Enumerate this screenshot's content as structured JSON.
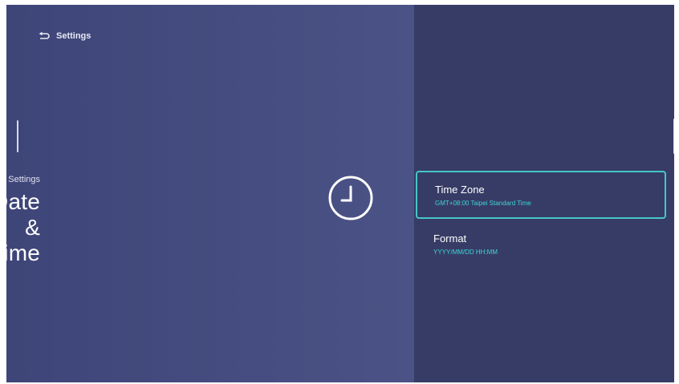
{
  "nav": {
    "back_label": "Settings",
    "back_icon": "back-arrow-icon"
  },
  "header": {
    "subtitle": "Settings",
    "title": "Date & Time",
    "icon": "clock-icon"
  },
  "menu": {
    "items": [
      {
        "title": "Time Zone",
        "value": "GMT+08:00 Taipei Standard Time",
        "focused": true
      },
      {
        "title": "Format",
        "value": "YYYY/MM/DD HH:MM",
        "focused": false
      }
    ]
  },
  "colors": {
    "left_pane": "#4b5386",
    "right_pane": "#373c66",
    "focus_border": "#46c6c4",
    "value_text": "#3fd4d2"
  }
}
